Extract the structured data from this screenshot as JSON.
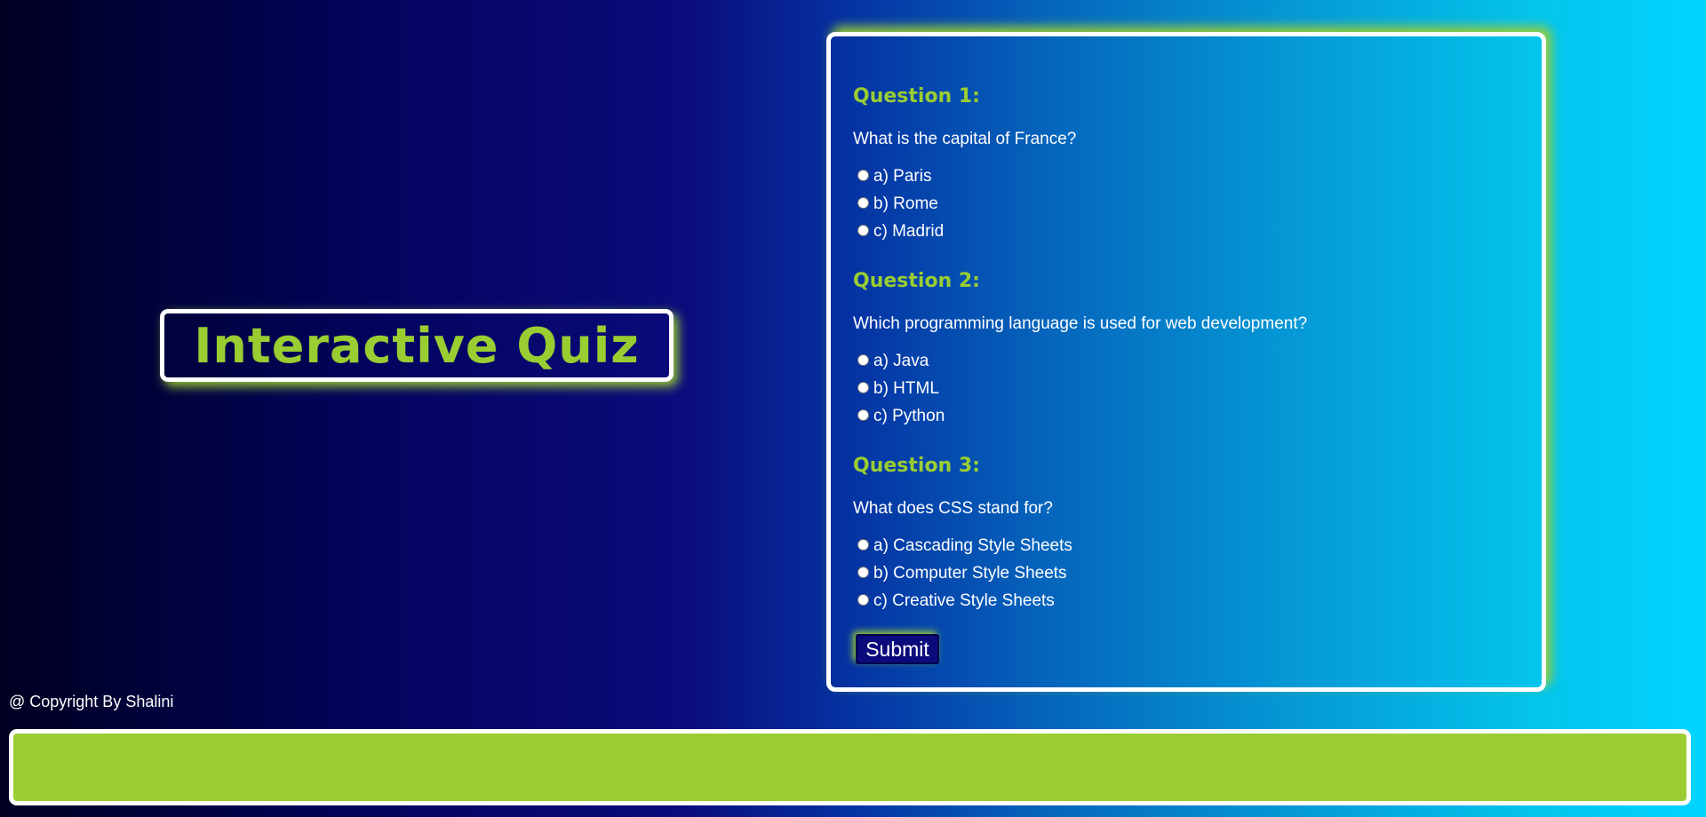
{
  "title": "Interactive Quiz",
  "colors": {
    "accent": "#9acd32",
    "panel_border": "#ffffff",
    "text": "#ffffff",
    "button_bg": "#0b0b7c"
  },
  "quiz": {
    "questions": [
      {
        "heading": "Question 1:",
        "text": "What is the capital of France?",
        "options": [
          "a) Paris",
          "b) Rome",
          "c) Madrid"
        ]
      },
      {
        "heading": "Question 2:",
        "text": "Which programming language is used for web development?",
        "options": [
          "a) Java",
          "b) HTML",
          "c) Python"
        ]
      },
      {
        "heading": "Question 3:",
        "text": "What does CSS stand for?",
        "options": [
          "a) Cascading Style Sheets",
          "b) Computer Style Sheets",
          "c) Creative Style Sheets"
        ]
      }
    ],
    "submit_label": "Submit"
  },
  "footer": {
    "copyright": "@ Copyright By Shalini"
  }
}
